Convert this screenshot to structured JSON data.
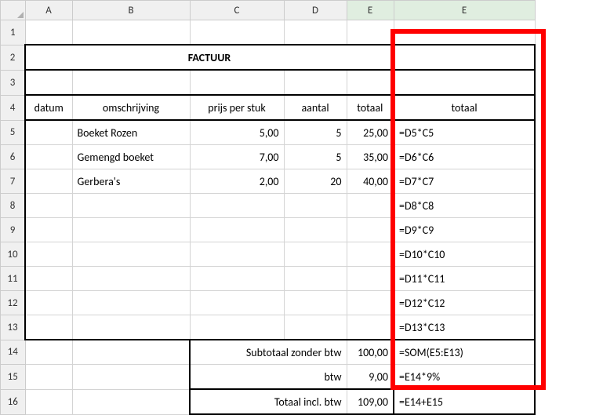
{
  "columns": [
    "A",
    "B",
    "C",
    "D",
    "E",
    "E"
  ],
  "title": "FACTUUR",
  "headers": {
    "A": "datum",
    "B": "omschrijving",
    "C": "prijs per stuk",
    "D": "aantal",
    "E1": "totaal",
    "E2": "totaal"
  },
  "rows": {
    "5": {
      "B": "Boeket Rozen",
      "C": "5,00",
      "D": "5",
      "E1": "25,00",
      "E2": "=D5*C5"
    },
    "6": {
      "B": "Gemengd boeket",
      "C": "7,00",
      "D": "5",
      "E1": "35,00",
      "E2": "=D6*C6"
    },
    "7": {
      "B": "Gerbera's",
      "C": "2,00",
      "D": "20",
      "E1": "40,00",
      "E2": "=D7*C7"
    },
    "8": {
      "E2": "=D8*C8"
    },
    "9": {
      "E2": "=D9*C9"
    },
    "10": {
      "E2": "=D10*C10"
    },
    "11": {
      "E2": "=D11*C11"
    },
    "12": {
      "E2": "=D12*C12"
    },
    "13": {
      "E2": "=D13*C13"
    }
  },
  "footer": {
    "subtotal_label": "Subtotaal zonder btw",
    "subtotal_value": "100,00",
    "subtotal_formula": "=SOM(E5:E13)",
    "btw_label": "btw",
    "btw_value": "9,00",
    "btw_formula": "=E14*9%",
    "total_label": "Totaal incl. btw",
    "total_value": "109,00",
    "total_formula": "=E14+E15"
  }
}
